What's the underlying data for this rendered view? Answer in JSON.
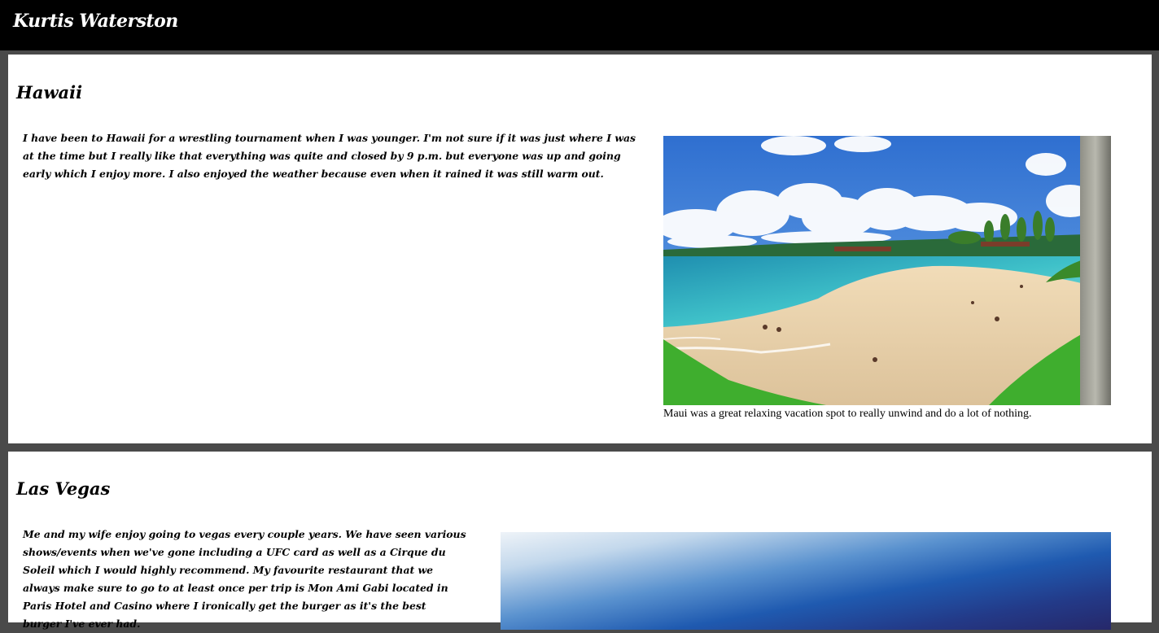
{
  "header": {
    "site_title": "Kurtis Waterston"
  },
  "sections": [
    {
      "title": "Hawaii",
      "text": "I have been to Hawaii for a wrestling tournament when I was younger. I'm not sure if it was just where I was at the time but I really like that everything was quite and closed by 9 p.m. but everyone was up and going early which I enjoy more. I also enjoyed the weather because even when it rained it was still warm out.",
      "caption": "Maui was a great relaxing vacation spot to really unwind and do a lot of nothing."
    },
    {
      "title": "Las Vegas",
      "text": "Me and my wife enjoy going to vegas every couple years. We have seen various shows/events when we've gone including a UFC card as well as a Cirque du Soleil which I would highly recommend. My favourite restaurant that we always make sure to go to at least once per trip is Mon Ami Gabi located in Paris Hotel and Casino where I ironically get the burger as it's the best burger I've ever had."
    }
  ],
  "colors": {
    "header_bg": "#000000",
    "page_bg": "#4a4a4a",
    "card_bg": "#ffffff"
  }
}
